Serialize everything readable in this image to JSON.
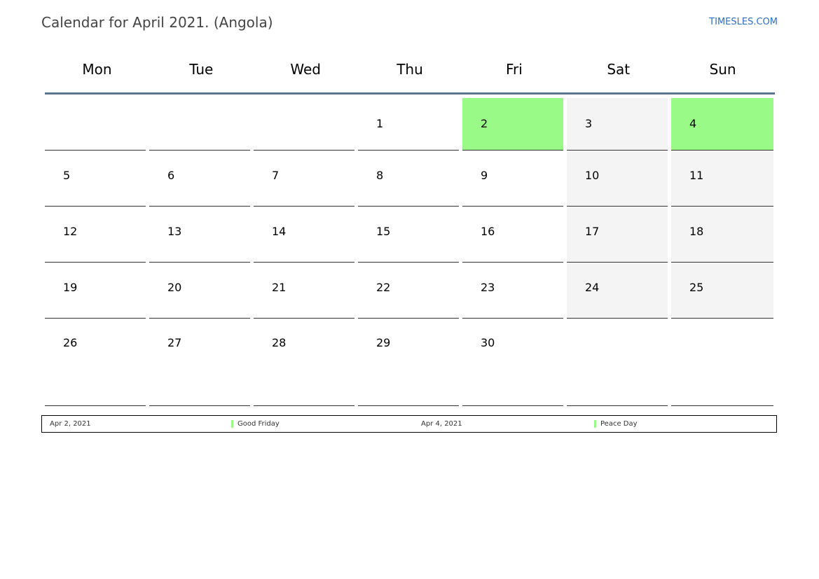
{
  "header": {
    "title": "Calendar for April 2021. (Angola)",
    "site": "TIMESLES.COM"
  },
  "colors": {
    "holiday": "#99fa88",
    "weekend": "#f4f4f4",
    "header_rule": "#5b7496",
    "link": "#2f6fbf"
  },
  "weekdays": [
    "Mon",
    "Tue",
    "Wed",
    "Thu",
    "Fri",
    "Sat",
    "Sun"
  ],
  "weeks": [
    [
      "",
      "",
      "",
      "1",
      "2",
      "3",
      "4"
    ],
    [
      "5",
      "6",
      "7",
      "8",
      "9",
      "10",
      "11"
    ],
    [
      "12",
      "13",
      "14",
      "15",
      "16",
      "17",
      "18"
    ],
    [
      "19",
      "20",
      "21",
      "22",
      "23",
      "24",
      "25"
    ],
    [
      "26",
      "27",
      "28",
      "29",
      "30",
      "",
      ""
    ]
  ],
  "holiday_days": [
    "2",
    "4"
  ],
  "holidays": [
    {
      "date": "Apr 2, 2021",
      "name": "Good Friday"
    },
    {
      "date": "Apr 4, 2021",
      "name": "Peace Day"
    }
  ]
}
